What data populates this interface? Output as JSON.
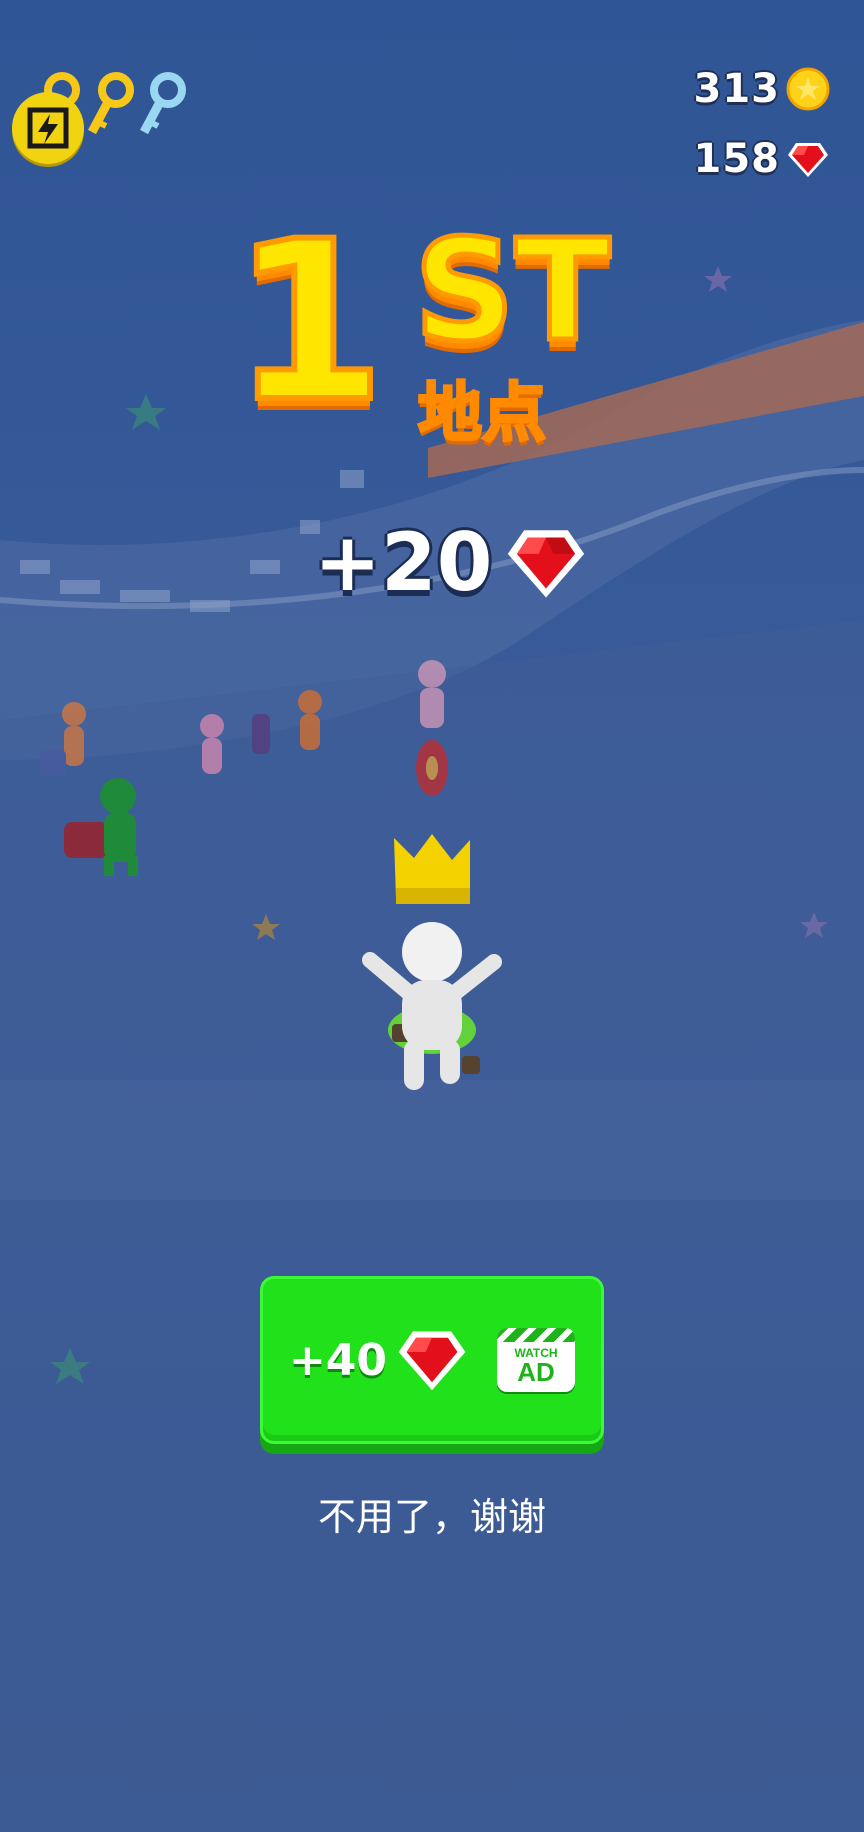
{
  "hud": {
    "coins": "313",
    "gems": "158",
    "icons": [
      "bolt-badge-icon",
      "gold-key-icon",
      "gold-key-icon",
      "blue-key-icon",
      "coin-icon",
      "gem-icon"
    ]
  },
  "result": {
    "place_number": "1",
    "place_suffix": "ST",
    "place_label": "地点",
    "reward_text": "+20"
  },
  "ad_button": {
    "reward_text": "+40",
    "watch_label": "WATCH",
    "ad_label": "AD"
  },
  "decline_label": "不用了，谢谢",
  "colors": {
    "background": "#34538e",
    "title_yellow": "#ffe600",
    "title_orange": "#ff9a00",
    "button_green": "#20e11a",
    "gem_red": "#e3101c",
    "coin_gold": "#ffd21a"
  }
}
